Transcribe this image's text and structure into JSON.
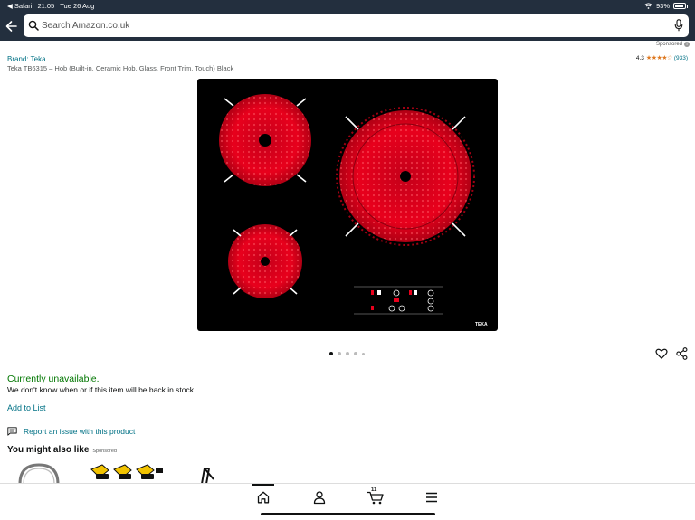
{
  "status_bar": {
    "back_app": "◀ Safari",
    "time": "21:05",
    "date": "Tue 26 Aug",
    "battery": "93%",
    "battery_level": 0.93
  },
  "search": {
    "placeholder": "Search Amazon.co.uk"
  },
  "sponsored_label": "Sponsored",
  "product": {
    "brand": "Brand: Teka",
    "title": "Teka TB6315 – Hob (Built-in, Ceramic Hob, Glass, Front Trim, Touch) Black",
    "rating": "4.3",
    "rating_value": 4.3,
    "stars": "★★★★☆",
    "rating_count": "(933)",
    "image_brand": "TEKA",
    "image_count": 5,
    "active_image": 1
  },
  "availability": {
    "status": "Currently unavailable.",
    "note": "We don't know when or if this item will be back in stock."
  },
  "actions": {
    "add_to_list": "Add to List",
    "report": "Report an issue with this product"
  },
  "recommendations": {
    "title": "You might also like",
    "sponsored": "Sponsored"
  },
  "bottom_nav": {
    "items": [
      "home-icon",
      "profile-icon",
      "cart-icon",
      "menu-icon"
    ],
    "cart_count": "11",
    "active": "home"
  },
  "colors": {
    "header_bg": "#232f3e",
    "link": "#007185",
    "available_green": "#007600",
    "star": "#de7921",
    "burner_red": "#e8001c"
  }
}
